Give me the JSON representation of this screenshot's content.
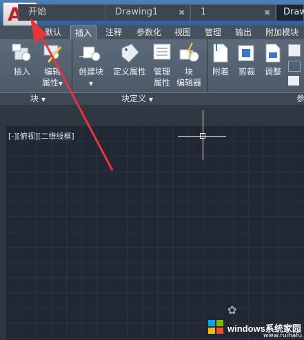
{
  "app": {
    "logo_letter": "A",
    "brand_color": "#c8202a"
  },
  "quick_access": {
    "icons": [
      "new-icon",
      "open-icon",
      "save-icon",
      "save-as-icon",
      "print-icon",
      "undo-icon",
      "redo-icon",
      "customize-icon"
    ]
  },
  "ribbon_tabs": [
    "默认",
    "插入",
    "注释",
    "参数化",
    "视图",
    "管理",
    "输出",
    "附加模块"
  ],
  "active_tab": "插入",
  "ribbon": {
    "tools": [
      {
        "label1": "插入",
        "label2": "",
        "icon": "insert-block-icon"
      },
      {
        "label1": "编辑",
        "label2": "属性",
        "icon": "edit-attribute-icon"
      },
      {
        "label1": "创建块",
        "label2": "",
        "icon": "create-block-icon"
      },
      {
        "label1": "定义属性",
        "label2": "",
        "icon": "define-attributes-icon"
      },
      {
        "label1": "管理",
        "label2": "属性",
        "icon": "manage-attributes-icon"
      },
      {
        "label1": "块",
        "label2": "编辑器",
        "icon": "block-editor-icon"
      },
      {
        "label1": "附着",
        "label2": "",
        "icon": "attach-icon"
      },
      {
        "label1": "剪裁",
        "label2": "",
        "icon": "clip-icon"
      },
      {
        "label1": "调整",
        "label2": "",
        "icon": "adjust-icon"
      }
    ],
    "panels": [
      "块",
      "块定义",
      "参"
    ]
  },
  "doc_tabs": [
    "开始",
    "Drawing1",
    "1",
    "Draw"
  ],
  "viewport_label": "[-][俯视][二维线框]",
  "watermark": {
    "text": "windows系统家园",
    "sub": "www.ruihafu.com"
  },
  "annotation": {
    "color": "#e8343a"
  }
}
